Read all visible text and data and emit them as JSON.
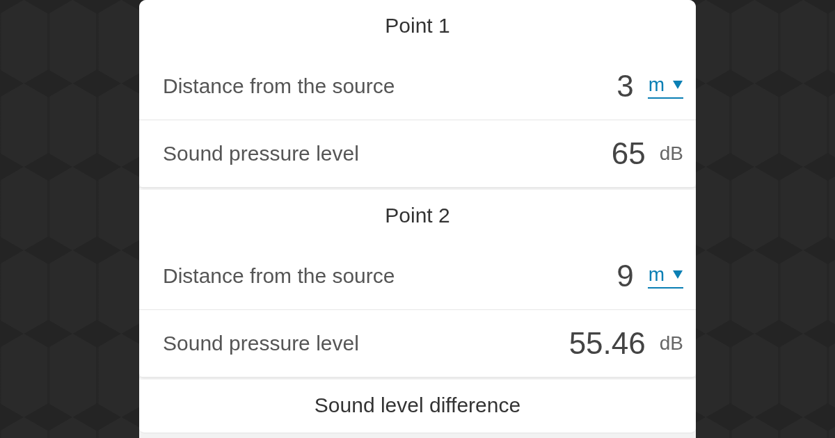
{
  "sections": [
    {
      "title": "Point 1",
      "rows": [
        {
          "kind": "select",
          "label": "Distance from the source",
          "value": "3",
          "unit": "m"
        },
        {
          "kind": "fixed",
          "label": "Sound pressure level",
          "value": "65",
          "unit": "dB"
        }
      ]
    },
    {
      "title": "Point 2",
      "rows": [
        {
          "kind": "select",
          "label": "Distance from the source",
          "value": "9",
          "unit": "m"
        },
        {
          "kind": "fixed",
          "label": "Sound pressure level",
          "value": "55.46",
          "unit": "dB"
        }
      ]
    },
    {
      "title": "Sound level difference"
    }
  ]
}
